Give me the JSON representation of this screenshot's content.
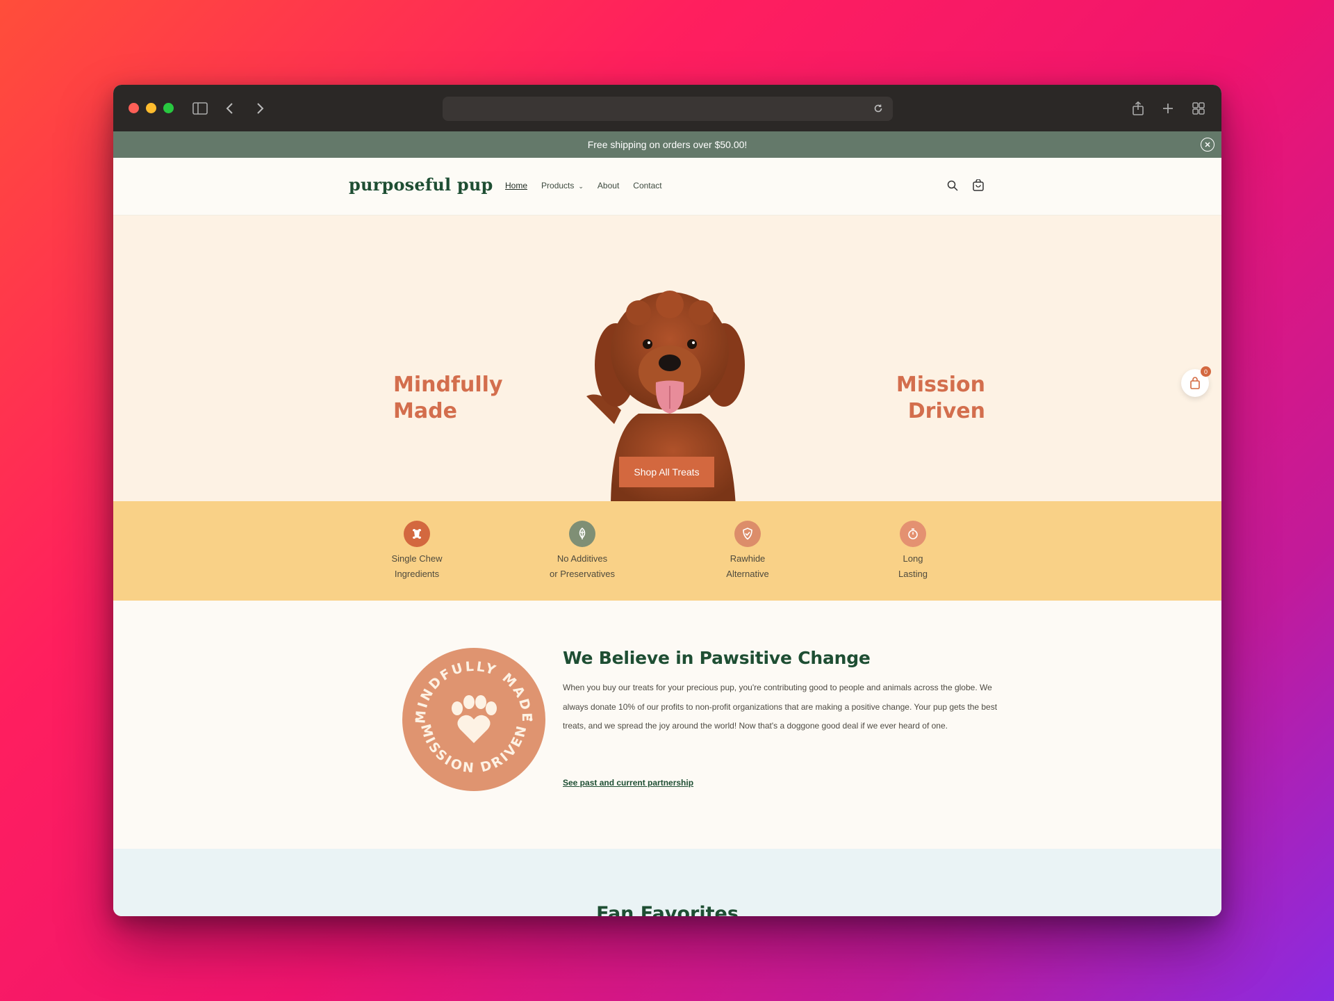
{
  "browser": {
    "url": ""
  },
  "announcement": {
    "text": "Free shipping on orders over $50.00!"
  },
  "header": {
    "logo": "purposeful pup",
    "nav": [
      {
        "label": "Home"
      },
      {
        "label": "Products"
      },
      {
        "label": "About"
      },
      {
        "label": "Contact"
      }
    ]
  },
  "hero": {
    "left_line1": "Mindfully",
    "left_line2": "Made",
    "right_line1": "Mission",
    "right_line2": "Driven",
    "cta": "Shop All Treats",
    "cart_count": "0"
  },
  "features": [
    {
      "line1": "Single Chew",
      "line2": "Ingredients",
      "icon": "bone-icon",
      "color": "#d3683f"
    },
    {
      "line1": "No Additives",
      "line2": "or Preservatives",
      "icon": "leaf-icon",
      "color": "#7f8f75"
    },
    {
      "line1": "Rawhide",
      "line2": "Alternative",
      "icon": "shield-icon",
      "color": "#dc8d6a"
    },
    {
      "line1": "Long",
      "line2": "Lasting",
      "icon": "timer-icon",
      "color": "#e49171"
    }
  ],
  "believe": {
    "badge_top": "MINDFULLY MADE",
    "badge_bottom": "MISSION DRIVEN",
    "title": "We Believe in Pawsitive Change",
    "body": "When you buy our treats for your precious pup, you're contributing good to people and animals across the globe. We always donate 10% of our profits to non-profit organizations that are making a positive change. Your pup gets the best treats, and we spread the joy around the world! Now that's a doggone good deal if we ever heard of one.",
    "link": "See past and current partnership"
  },
  "fan": {
    "title": "Fan Favorites"
  },
  "colors": {
    "brand_green": "#1e4e33",
    "accent_orange": "#d3683f",
    "announcement_bg": "#64796a",
    "hero_bg": "#fdf2e4",
    "features_bg": "#f9d187"
  }
}
